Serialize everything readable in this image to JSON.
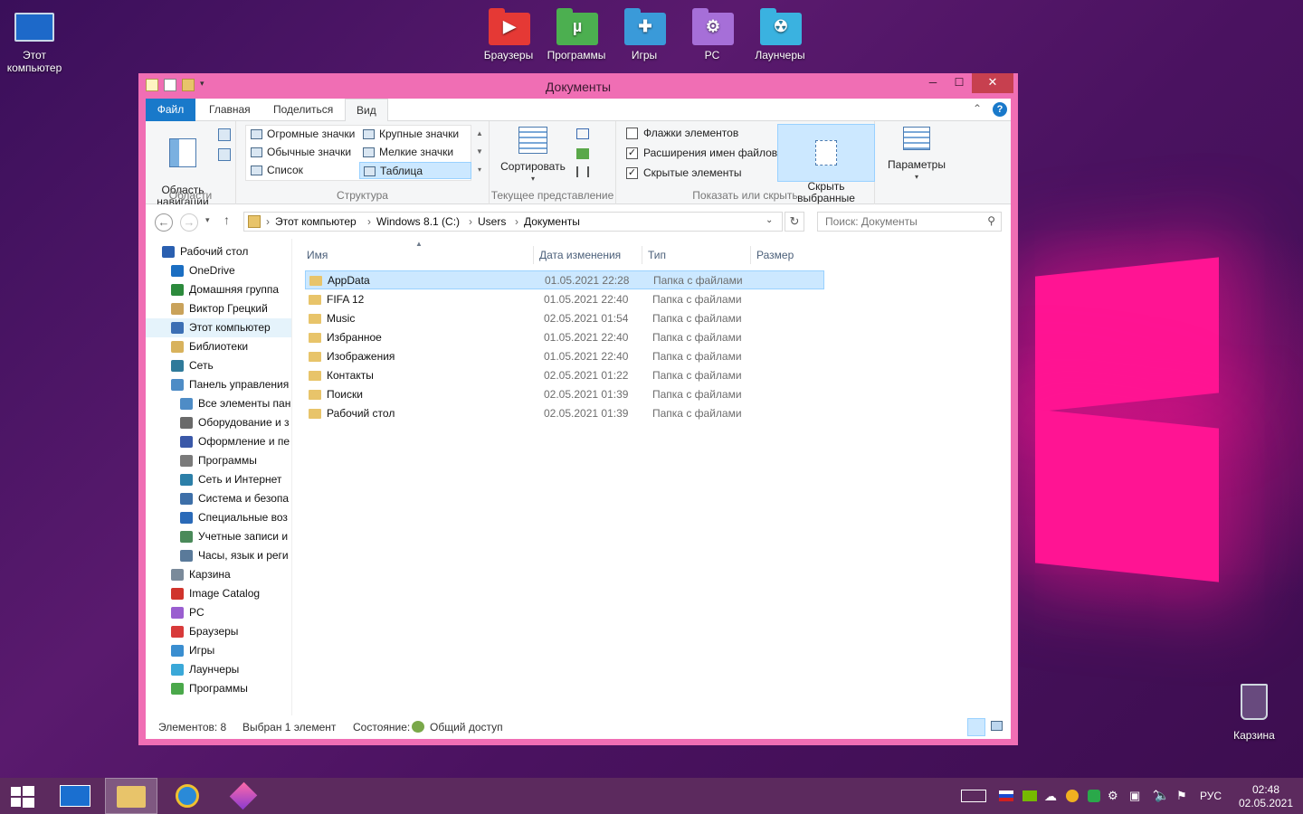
{
  "desktop": {
    "icons": [
      {
        "label": "Этот\nкомпьютер"
      },
      {
        "label": "Браузеры"
      },
      {
        "label": "Программы"
      },
      {
        "label": "Игры"
      },
      {
        "label": "PC"
      },
      {
        "label": "Лаунчеры"
      },
      {
        "label": "Карзина"
      }
    ]
  },
  "window": {
    "title": "Документы",
    "minimize": "─",
    "maximize": "☐",
    "close": "✕"
  },
  "ribbon": {
    "tabs": [
      "Файл",
      "Главная",
      "Поделиться",
      "Вид"
    ],
    "areas": {
      "nav_pane_label": "Область\nнавигации",
      "group_label": "Области"
    },
    "structure": {
      "items": [
        "Огромные значки",
        "Крупные значки",
        "Обычные значки",
        "Мелкие значки",
        "Список",
        "Таблица"
      ],
      "group_label": "Структура"
    },
    "current_view": {
      "sort_label": "Сортировать",
      "group_label": "Текущее представление"
    },
    "show_hide": {
      "checkboxes": [
        {
          "label": "Флажки элементов",
          "checked": false
        },
        {
          "label": "Расширения имен файлов",
          "checked": true
        },
        {
          "label": "Скрытые элементы",
          "checked": true
        }
      ],
      "hide_selected_label": "Скрыть выбранные\nэлементы",
      "group_label": "Показать или скрыть"
    },
    "options_label": "Параметры"
  },
  "address": {
    "crumbs": [
      "Этот компьютер",
      "Windows 8.1 (C:)",
      "Users",
      "Документы"
    ],
    "search_placeholder": "Поиск: Документы"
  },
  "nav_pane": {
    "items": [
      {
        "label": "Рабочий стол",
        "icon": "desktop-icon",
        "indent": 0,
        "color": "#2a5fb0"
      },
      {
        "label": "OneDrive",
        "icon": "cloud-icon",
        "indent": 1,
        "color": "#1b6ec2"
      },
      {
        "label": "Домашняя группа",
        "icon": "homegroup-icon",
        "indent": 1,
        "color": "#2c8a3c"
      },
      {
        "label": "Виктор Грецкий",
        "icon": "user-folder-icon",
        "indent": 1,
        "color": "#c9a25a"
      },
      {
        "label": "Этот компьютер",
        "icon": "computer-icon",
        "indent": 1,
        "color": "#3c6fb4",
        "selected": true
      },
      {
        "label": "Библиотеки",
        "icon": "library-icon",
        "indent": 1,
        "color": "#d8b25c"
      },
      {
        "label": "Сеть",
        "icon": "network-icon",
        "indent": 1,
        "color": "#2f7a9a"
      },
      {
        "label": "Панель управления",
        "icon": "control-panel-icon",
        "indent": 1,
        "color": "#4e8cc6"
      },
      {
        "label": "Все элементы пан",
        "icon": "control-panel-icon",
        "indent": 2,
        "color": "#4e8cc6"
      },
      {
        "label": "Оборудование и з",
        "icon": "hardware-icon",
        "indent": 2,
        "color": "#6a6a6a"
      },
      {
        "label": "Оформление и пе",
        "icon": "appearance-icon",
        "indent": 2,
        "color": "#3a58a8"
      },
      {
        "label": "Программы",
        "icon": "programs-icon",
        "indent": 2,
        "color": "#7a7a7a"
      },
      {
        "label": "Сеть и Интернет",
        "icon": "network-internet-icon",
        "indent": 2,
        "color": "#2c7fa8"
      },
      {
        "label": "Система и безопа",
        "icon": "security-icon",
        "indent": 2,
        "color": "#3d6fa8"
      },
      {
        "label": "Специальные воз",
        "icon": "accessibility-icon",
        "indent": 2,
        "color": "#2a6ab8"
      },
      {
        "label": "Учетные записи и",
        "icon": "accounts-icon",
        "indent": 2,
        "color": "#4a8a5a"
      },
      {
        "label": "Часы, язык и реги",
        "icon": "clock-icon",
        "indent": 2,
        "color": "#5a7a9a"
      },
      {
        "label": "Карзина",
        "icon": "recycle-bin-icon",
        "indent": 1,
        "color": "#7a8a9a"
      },
      {
        "label": "Image Catalog",
        "icon": "image-catalog-icon",
        "indent": 1,
        "color": "#d0342c"
      },
      {
        "label": "PC",
        "icon": "pc-folder-icon",
        "indent": 1,
        "color": "#9a5ed0"
      },
      {
        "label": "Браузеры",
        "icon": "browsers-folder-icon",
        "indent": 1,
        "color": "#d83a3a"
      },
      {
        "label": "Игры",
        "icon": "games-folder-icon",
        "indent": 1,
        "color": "#3a8ed0"
      },
      {
        "label": "Лаунчеры",
        "icon": "launchers-folder-icon",
        "indent": 1,
        "color": "#3aa8d8"
      },
      {
        "label": "Программы",
        "icon": "programs-folder-icon",
        "indent": 1,
        "color": "#4aa84a"
      }
    ]
  },
  "file_list": {
    "columns": [
      "Имя",
      "Дата изменения",
      "Тип",
      "Размер"
    ],
    "rows": [
      {
        "name": "AppData",
        "date": "01.05.2021 22:28",
        "type": "Папка с файлами",
        "selected": true
      },
      {
        "name": "FIFA 12",
        "date": "01.05.2021 22:40",
        "type": "Папка с файлами"
      },
      {
        "name": "Music",
        "date": "02.05.2021 01:54",
        "type": "Папка с файлами"
      },
      {
        "name": "Избранное",
        "date": "01.05.2021 22:40",
        "type": "Папка с файлами"
      },
      {
        "name": "Изображения",
        "date": "01.05.2021 22:40",
        "type": "Папка с файлами"
      },
      {
        "name": "Контакты",
        "date": "02.05.2021 01:22",
        "type": "Папка с файлами"
      },
      {
        "name": "Поиски",
        "date": "02.05.2021 01:39",
        "type": "Папка с файлами"
      },
      {
        "name": "Рабочий стол",
        "date": "02.05.2021 01:39",
        "type": "Папка с файлами"
      }
    ]
  },
  "status_bar": {
    "count": "Элементов: 8",
    "selected": "Выбран 1 элемент",
    "state_label": "Состояние:",
    "state_value": "Общий доступ"
  },
  "taskbar": {
    "lang": "РУС",
    "time": "02:48",
    "date": "02.05.2021"
  },
  "colors": {
    "accent": "#1979ca",
    "window_frame": "#f06eb4",
    "wallpaper_logo": "#ff1493",
    "taskbar": "#5c2a5e"
  }
}
